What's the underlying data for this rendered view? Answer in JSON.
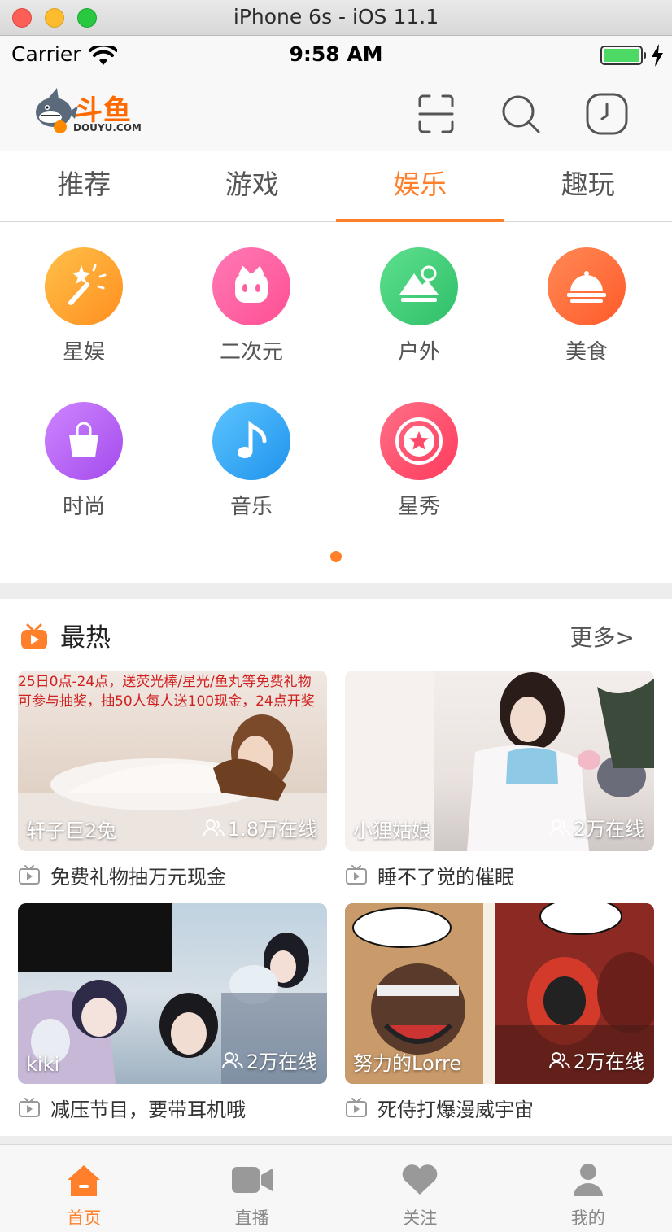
{
  "window": {
    "title": "iPhone 6s - iOS 11.1"
  },
  "status_bar": {
    "carrier": "Carrier",
    "time": "9:58 AM"
  },
  "header": {
    "brand": "斗鱼",
    "domain": "DOUYU.COM"
  },
  "tabs": [
    {
      "label": "推荐",
      "active": false
    },
    {
      "label": "游戏",
      "active": false
    },
    {
      "label": "娱乐",
      "active": true
    },
    {
      "label": "趣玩",
      "active": false
    }
  ],
  "categories": [
    {
      "label": "星娱",
      "icon": "magic-wand-icon",
      "color": "#ffa62b"
    },
    {
      "label": "二次元",
      "icon": "anime-face-icon",
      "color": "#ff5fa2"
    },
    {
      "label": "户外",
      "icon": "mountain-icon",
      "color": "#3fcf78"
    },
    {
      "label": "美食",
      "icon": "food-cloche-icon",
      "color": "#ff6a3a"
    },
    {
      "label": "时尚",
      "icon": "shopping-bag-icon",
      "color": "#b865f0"
    },
    {
      "label": "音乐",
      "icon": "music-note-icon",
      "color": "#2fa8f5"
    },
    {
      "label": "星秀",
      "icon": "star-badge-icon",
      "color": "#ff4b6b"
    }
  ],
  "hot": {
    "title": "最热",
    "more": "更多>",
    "cards": [
      {
        "anchor": "轩子巨2兔",
        "online": "1.8万在线",
        "title": "免费礼物抽万元现金",
        "overlay_lines": [
          "25日0点-24点，送荧光棒/星光/鱼丸等免费礼物",
          "可参与抽奖，抽50人每人送100现金，24点开奖"
        ]
      },
      {
        "anchor": "小狸姑娘",
        "online": "2万在线",
        "title": "睡不了觉的催眠",
        "overlay_lines": []
      },
      {
        "anchor": "kiki",
        "online": "2万在线",
        "title": "减压节目，要带耳机哦",
        "overlay_lines": []
      },
      {
        "anchor": "努力的Lorre",
        "online": "2万在线",
        "title": "死侍打爆漫威宇宙",
        "overlay_lines": []
      }
    ]
  },
  "bottom_tabs": [
    {
      "label": "首页",
      "icon": "home-icon",
      "active": true
    },
    {
      "label": "直播",
      "icon": "video-camera-icon",
      "active": false
    },
    {
      "label": "关注",
      "icon": "heart-icon",
      "active": false
    },
    {
      "label": "我的",
      "icon": "user-icon",
      "active": false
    }
  ],
  "colors": {
    "accent": "#ff7f2a",
    "divider": "#ededed"
  }
}
